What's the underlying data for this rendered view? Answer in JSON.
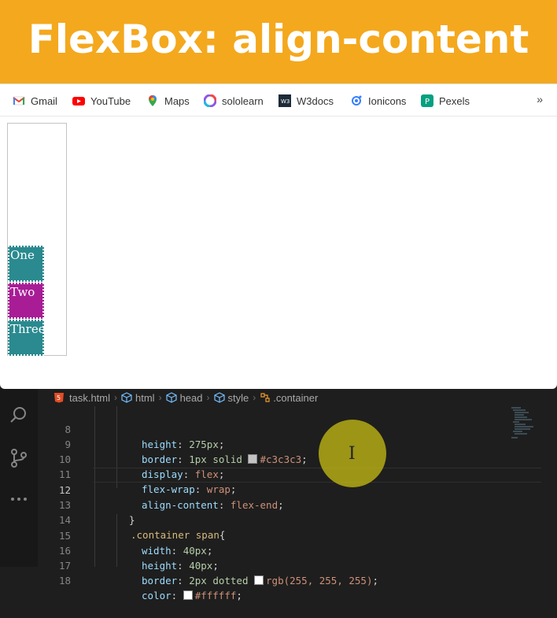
{
  "banner": {
    "title": "FlexBox: align-content",
    "bg": "#f4a81d"
  },
  "bookmarks": {
    "items": [
      {
        "label": "Gmail",
        "icon": "gmail-icon"
      },
      {
        "label": "YouTube",
        "icon": "youtube-icon"
      },
      {
        "label": "Maps",
        "icon": "maps-icon"
      },
      {
        "label": "sololearn",
        "icon": "sololearn-icon"
      },
      {
        "label": "W3docs",
        "icon": "w3docs-icon"
      },
      {
        "label": "Ionicons",
        "icon": "ionicons-icon"
      },
      {
        "label": "Pexels",
        "icon": "pexels-icon"
      }
    ],
    "more": "»"
  },
  "demo": {
    "boxes": [
      {
        "label": "One",
        "color": "#2a8a8f"
      },
      {
        "label": "Two",
        "color": "#a81d96"
      },
      {
        "label": "Three",
        "color": "#2a8a8f"
      }
    ]
  },
  "breadcrumb": [
    "task.html",
    "html",
    "head",
    "style",
    ".container"
  ],
  "code": {
    "lines": [
      {
        "n": "8",
        "text": "height: 275px;"
      },
      {
        "n": "9",
        "text": "border: 1px solid #c3c3c3;"
      },
      {
        "n": "10",
        "text": "display: flex;"
      },
      {
        "n": "11",
        "text": "flex-wrap: wrap;"
      },
      {
        "n": "12",
        "text": "align-content: flex-end;"
      },
      {
        "n": "13",
        "text": "}"
      },
      {
        "n": "14",
        "text": ".container span{"
      },
      {
        "n": "15",
        "text": "width: 40px;"
      },
      {
        "n": "16",
        "text": "height: 40px;"
      },
      {
        "n": "17",
        "text": "border: 2px dotted rgb(255, 255, 255);"
      },
      {
        "n": "18",
        "text": "color: #ffffff;"
      }
    ],
    "tokens": {
      "l8": [
        "height",
        ": ",
        "275px",
        ";"
      ],
      "l9": [
        "border",
        ": ",
        "1px solid ",
        "#c3c3c3",
        ";"
      ],
      "l10": [
        "display",
        ": ",
        "flex",
        ";"
      ],
      "l11": [
        "flex-wrap",
        ": ",
        "wrap",
        ";"
      ],
      "l12": [
        "align-content",
        ": ",
        "flex-end",
        ";"
      ],
      "l13": [
        "}"
      ],
      "l14": [
        ".container span",
        "{"
      ],
      "l15": [
        "width",
        ": ",
        "40px",
        ";"
      ],
      "l16": [
        "height",
        ": ",
        "40px",
        ";"
      ],
      "l17": [
        "border",
        ": ",
        "2px dotted ",
        "rgb(255, 255, 255)",
        ";"
      ],
      "l18": [
        "color",
        ": ",
        "#ffffff",
        ";"
      ]
    },
    "current_line": "12"
  }
}
